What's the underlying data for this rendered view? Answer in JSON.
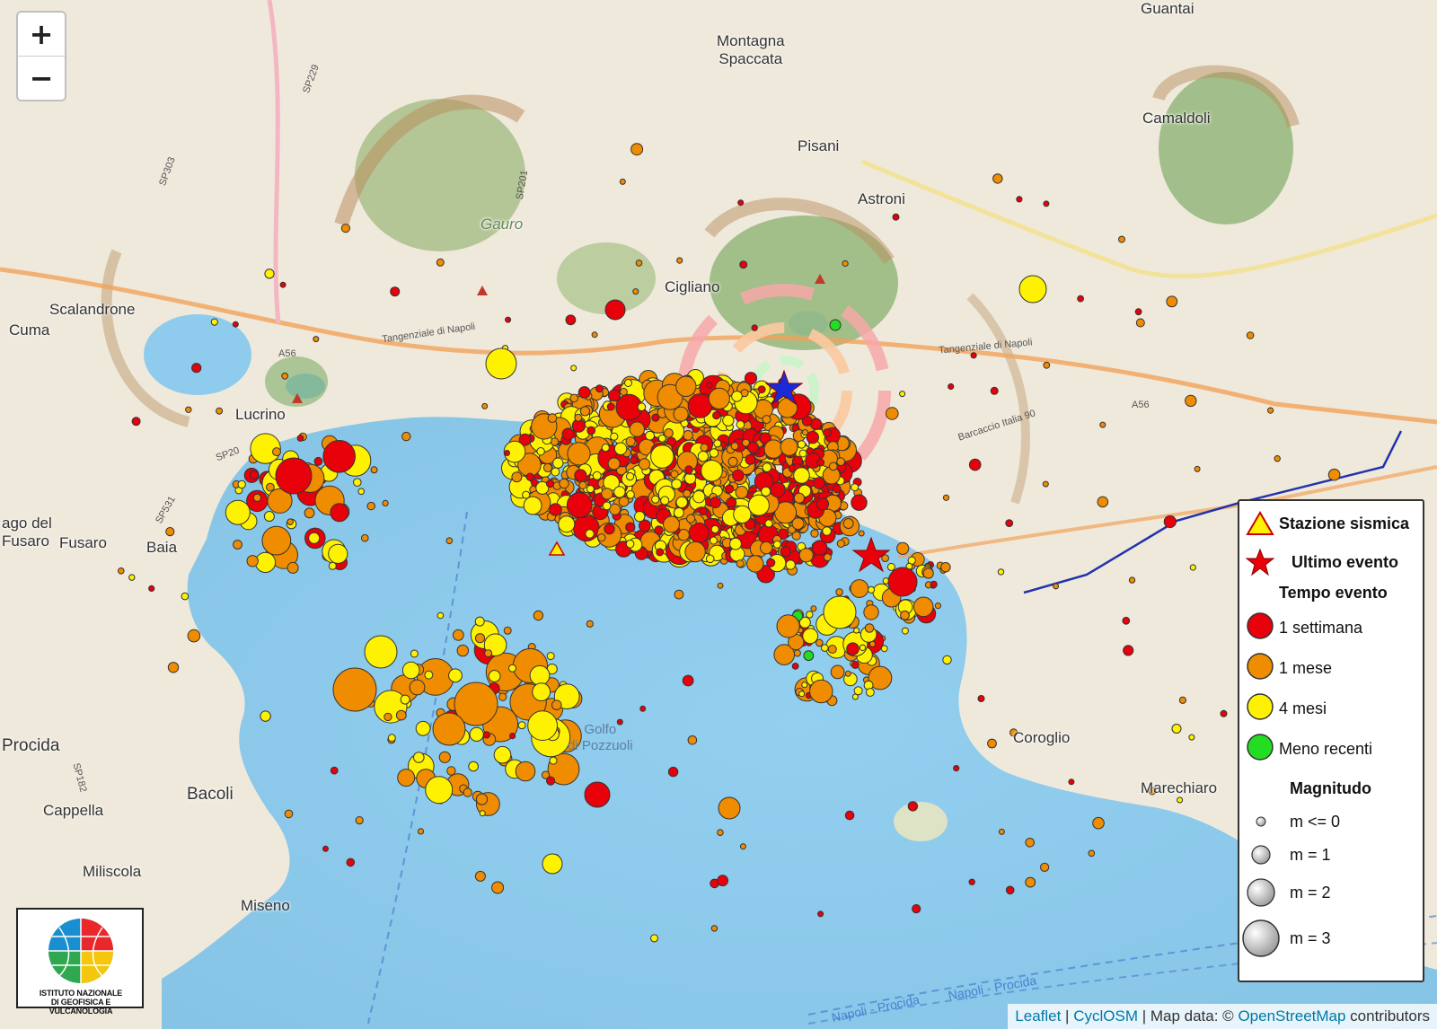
{
  "zoom": {
    "in_label": "+",
    "out_label": "−"
  },
  "place_labels": [
    {
      "name": "Montagna\nSpaccata"
    },
    {
      "name": "Pisani"
    },
    {
      "name": "Astroni"
    },
    {
      "name": "Camaldoli"
    },
    {
      "name": "Guantai"
    },
    {
      "name": "Gauro"
    },
    {
      "name": "Cigliano"
    },
    {
      "name": "Scalandrone"
    },
    {
      "name": "Cuma"
    },
    {
      "name": "Lucrino"
    },
    {
      "name": "ago del\nFusaro"
    },
    {
      "name": "Fusaro"
    },
    {
      "name": "Baia"
    },
    {
      "name": "Procida"
    },
    {
      "name": "Bacoli"
    },
    {
      "name": "Cappella"
    },
    {
      "name": "Miliscola"
    },
    {
      "name": "Miseno"
    },
    {
      "name": "Coroglio"
    },
    {
      "name": "Marechiaro"
    },
    {
      "name": "Golfo\ndi Pozzuoli"
    }
  ],
  "road_labels": [
    "Tangenziale di Napoli",
    "Tangenziale di Napoli",
    "Barcaccio Italia 90",
    "Napoli - Procida",
    "Napoli - Procida",
    "SP229",
    "SP303",
    "SP531",
    "SP201",
    "SP20",
    "SP182",
    "A56",
    "A56"
  ],
  "legend": {
    "station_label": "Stazione sismica",
    "last_event_label": "Ultimo evento",
    "time_title": "Tempo evento",
    "time_classes": [
      {
        "label": "1 settimana",
        "color": "#e8000b"
      },
      {
        "label": "1 mese",
        "color": "#f08c00"
      },
      {
        "label": "4 mesi",
        "color": "#fff200"
      },
      {
        "label": "Meno recenti",
        "color": "#22dd22"
      }
    ],
    "magnitude_title": "Magnitudo",
    "magnitude_classes": [
      {
        "label": "m <= 0"
      },
      {
        "label": "m = 1"
      },
      {
        "label": "m = 2"
      },
      {
        "label": "m = 3"
      }
    ]
  },
  "logo": {
    "text": "ISTITUTO NAZIONALE\nDI GEOFISICA E VULCANOLOGIA"
  },
  "attribution": {
    "leaflet": "Leaflet",
    "sep": " | ",
    "cyclosm": "CyclOSM",
    "mapdata": " | Map data: © ",
    "osm": "OpenStreetMap",
    "contributors": " contributors"
  },
  "colors": {
    "sea": "#8ecbec",
    "land": "#efe9dc",
    "green_area": "#9bbd74",
    "red": "#e8000b",
    "orange": "#f08c00",
    "yellow": "#fff200",
    "green": "#22dd22",
    "last_event": "#e8000b",
    "current_marker": "#1a2bd8"
  }
}
